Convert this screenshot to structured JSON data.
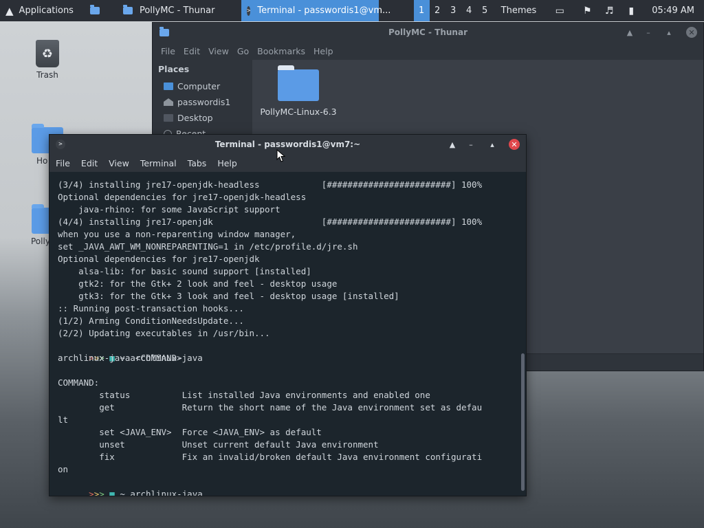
{
  "panel": {
    "apps_label": "Applications",
    "tasks": [
      {
        "label": ""
      },
      {
        "label": "PollyMC - Thunar"
      },
      {
        "label": "Terminal - passwordis1@vm..."
      }
    ],
    "workspaces": [
      "1",
      "2",
      "3",
      "4",
      "5"
    ],
    "themes_label": "Themes",
    "clock": "05:49 AM"
  },
  "desktop": {
    "icons": [
      {
        "label": "Trash"
      },
      {
        "label": "Ho"
      },
      {
        "label": "Polly"
      }
    ]
  },
  "thunar": {
    "title": "PollyMC - Thunar",
    "menu": [
      "File",
      "Edit",
      "View",
      "Go",
      "Bookmarks",
      "Help"
    ],
    "places_header": "Places",
    "places": [
      "Computer",
      "passwordis1",
      "Desktop",
      "Recent"
    ],
    "file_label": "PollyMC-Linux-6.3"
  },
  "terminal": {
    "title": "Terminal - passwordis1@vm7:~",
    "menu": [
      "File",
      "Edit",
      "View",
      "Terminal",
      "Tabs",
      "Help"
    ],
    "lines": [
      "(3/4) installing jre17-openjdk-headless            [########################] 100%",
      "Optional dependencies for jre17-openjdk-headless",
      "    java-rhino: for some JavaScript support",
      "(4/4) installing jre17-openjdk                     [########################] 100%",
      "when you use a non-reparenting window manager,",
      "set _JAVA_AWT_WM_NONREPARENTING=1 in /etc/profile.d/jre.sh",
      "Optional dependencies for jre17-openjdk",
      "    alsa-lib: for basic sound support [installed]",
      "    gtk2: for the Gtk+ 2 look and feel - desktop usage",
      "    gtk3: for the Gtk+ 3 look and feel - desktop usage [installed]",
      ":: Running post-transaction hooks...",
      "(1/2) Arming ConditionNeedsUpdate...",
      "(2/2) Updating executables in /usr/bin..."
    ],
    "prompt1_cmd": "~ archlinux-java",
    "lines2": [
      "archlinux-java <COMMAND>",
      "",
      "COMMAND:",
      "        status          List installed Java environments and enabled one",
      "        get             Return the short name of the Java environment set as defau",
      "lt",
      "        set <JAVA_ENV>  Force <JAVA_ENV> as default",
      "        unset           Unset current default Java environment",
      "        fix             Fix an invalid/broken default Java environment configurati",
      "on"
    ],
    "prompt2_cmd": "~ archlinux-java",
    "prompt_arrows": ">>>"
  },
  "icons": {
    "apps": "arch-logo-icon",
    "trash": "trash-icon"
  }
}
